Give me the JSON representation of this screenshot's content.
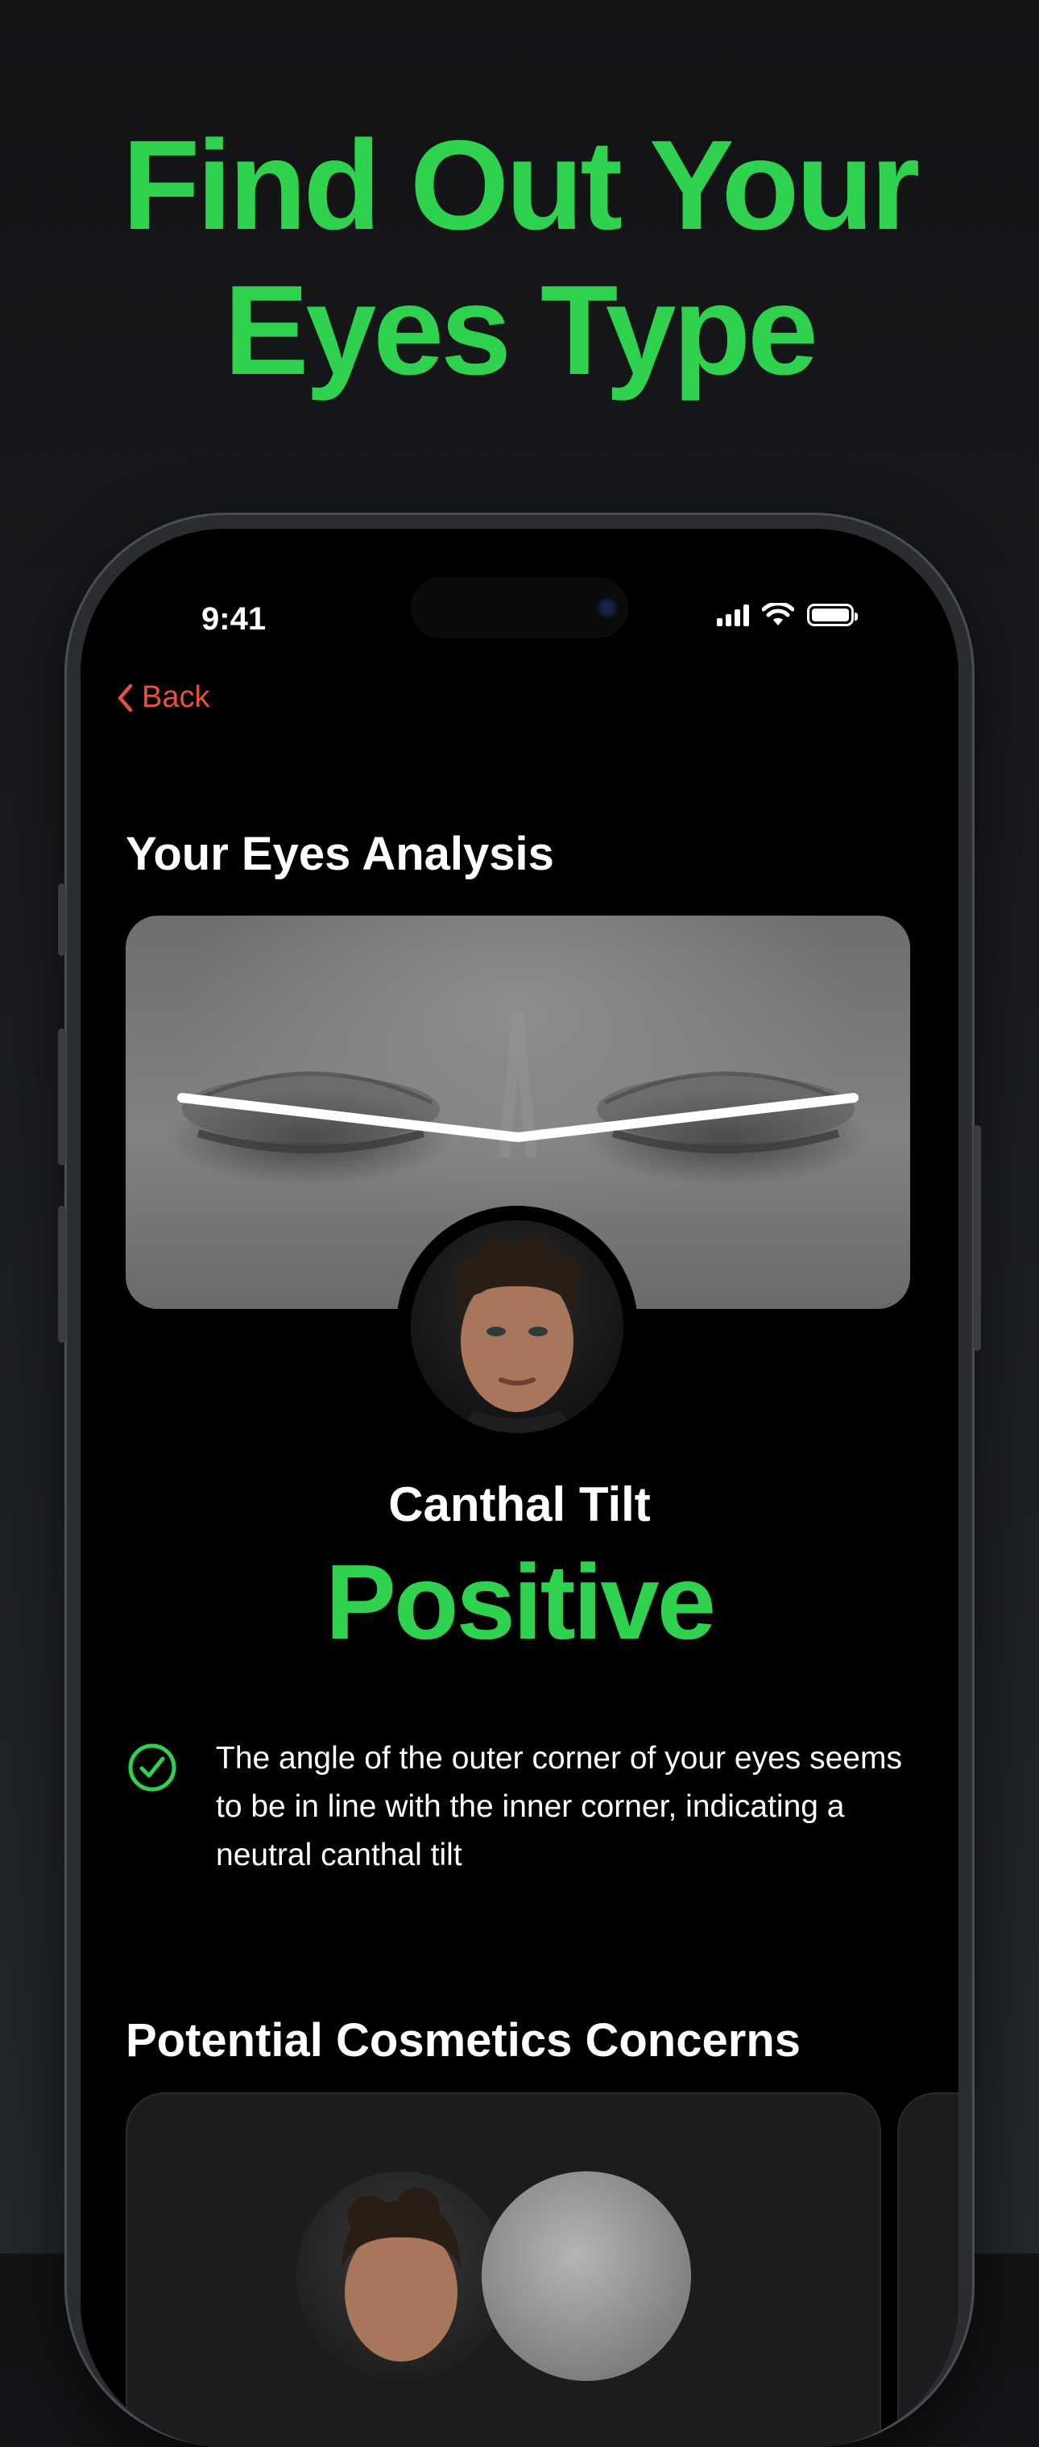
{
  "headline": {
    "line1": "Find Out Your",
    "line2": "Eyes Type"
  },
  "status_bar": {
    "time": "9:41",
    "icons": [
      "cellular-signal-icon",
      "wifi-icon",
      "battery-icon"
    ]
  },
  "nav": {
    "back_label": "Back"
  },
  "analysis": {
    "section_title": "Your Eyes Analysis",
    "metric_label": "Canthal Tilt",
    "metric_value": "Positive",
    "description": "The angle of the outer corner of your eyes seems to be in line with the inner corner, indicating a neutral canthal tilt"
  },
  "concerns": {
    "section_title": "Potential Cosmetics Concerns"
  },
  "colors": {
    "accent_green": "#2fd24f",
    "back_orange": "#e4543a",
    "screen_bg": "#000000",
    "card_bg": "#1c1c1e"
  }
}
